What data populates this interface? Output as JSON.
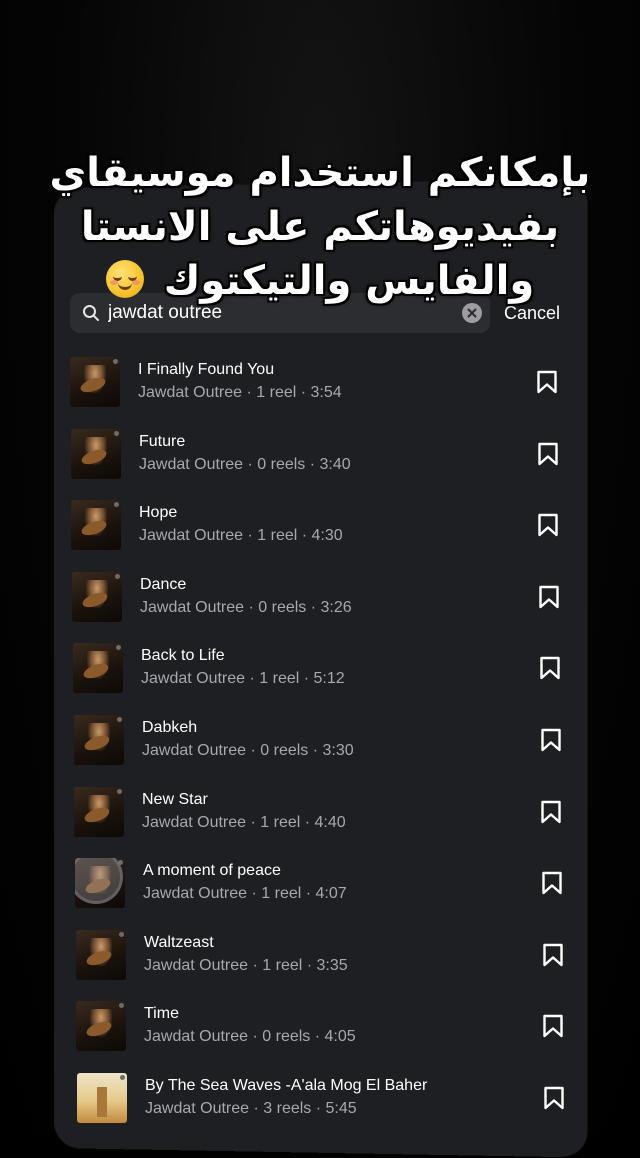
{
  "caption": {
    "line1": "بإمكانكم استخدام موسيقاي",
    "line2": "بفيديوهاتكم على الانستا",
    "line3": "والفايس والتيكتوك"
  },
  "search": {
    "value": "jawdat outree",
    "placeholder": "Search",
    "cancel_label": "Cancel",
    "search_icon": "search-icon",
    "clear_icon": "clear-icon"
  },
  "tracks": [
    {
      "title": "I Finally Found You",
      "subtitle": "Jawdat Outree · 1 reel · 3:54",
      "cover": "jawdat-album"
    },
    {
      "title": "Future",
      "subtitle": "Jawdat Outree · 0 reels · 3:40",
      "cover": "jawdat-album"
    },
    {
      "title": "Hope",
      "subtitle": "Jawdat Outree · 1 reel · 4:30",
      "cover": "jawdat-album"
    },
    {
      "title": "Dance",
      "subtitle": "Jawdat Outree · 0 reels · 3:26",
      "cover": "jawdat-album"
    },
    {
      "title": "Back to Life",
      "subtitle": "Jawdat Outree · 1 reel · 5:12",
      "cover": "jawdat-album"
    },
    {
      "title": "Dabkeh",
      "subtitle": "Jawdat Outree · 0 reels · 3:30",
      "cover": "jawdat-album"
    },
    {
      "title": "New Star",
      "subtitle": "Jawdat Outree · 1 reel · 4:40",
      "cover": "jawdat-album"
    },
    {
      "title": "A moment of peace",
      "subtitle": "Jawdat Outree · 1 reel · 4:07",
      "cover": "jawdat-album"
    },
    {
      "title": "Waltzeast",
      "subtitle": "Jawdat Outree · 1 reel · 3:35",
      "cover": "jawdat-album"
    },
    {
      "title": "Time",
      "subtitle": "Jawdat Outree · 0 reels · 4:05",
      "cover": "jawdat-album"
    },
    {
      "title": "By The Sea Waves -A'ala Mog El Baher",
      "subtitle": "Jawdat Outree · 3 reels · 5:45",
      "cover": "sea-album"
    }
  ],
  "icons": {
    "save": "bookmark-icon",
    "emoji": "smiling-face-icon"
  },
  "colors": {
    "background": "#000000",
    "panel": "#1e1f22",
    "search_box": "#2c2d31",
    "secondary_text": "#a8a8ad"
  }
}
